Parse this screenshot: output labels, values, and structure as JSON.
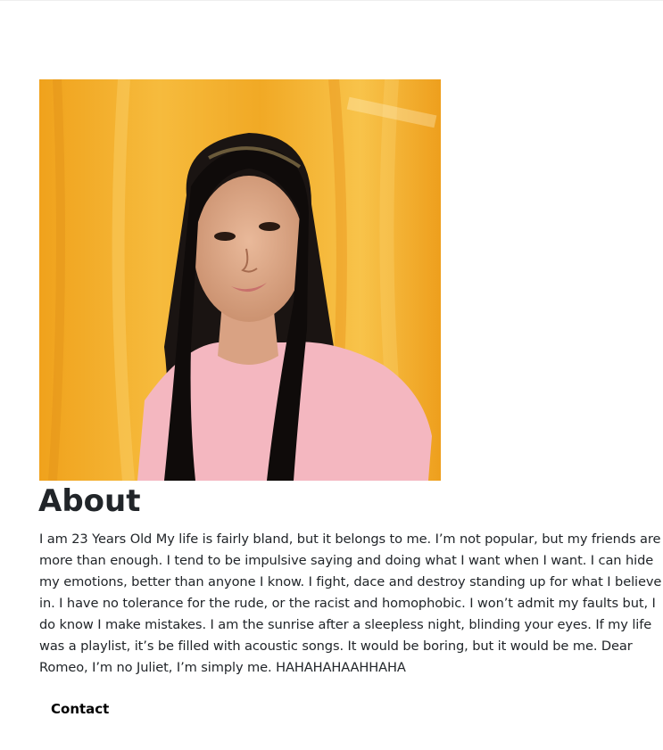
{
  "profile": {
    "photo_icon": "profile-photo"
  },
  "about": {
    "heading": "About",
    "text": "I am 23 Years Old My life is fairly bland, but it belongs to me. I’m not popular, but my friends are more than enough. I tend to be impulsive saying and doing what I want when I want. I can hide my emotions, better than anyone I know. I fight, dace and destroy standing up for what I believe in. I have no tolerance for the rude, or the racist and homophobic. I won’t admit my faults but, I do know I make mistakes. I am the sunrise after a sleepless night, blinding your eyes. If my life was a playlist, it’s be filled with acoustic songs. It would be boring, but it would be me. Dear Romeo, I’m no Juliet, I’m simply me. HAHAHAHAAHHAHA"
  },
  "nav": {
    "contact_label": "Contact"
  },
  "colors": {
    "text": "#212529",
    "link": "#000000",
    "photo_background": "#f2a82a",
    "shirt": "#f4b7c0"
  }
}
